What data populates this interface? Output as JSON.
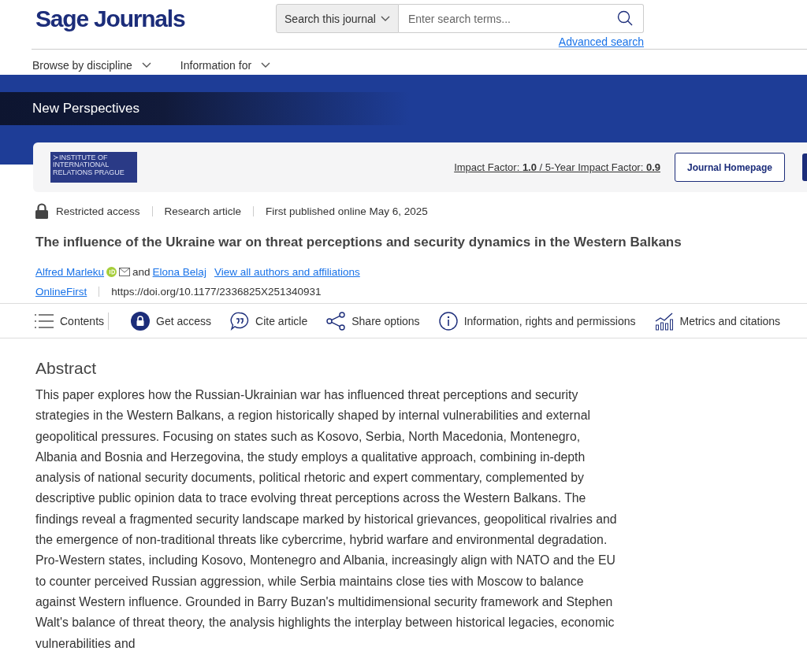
{
  "header": {
    "logo": "Sage Journals",
    "search": {
      "scope": "Search this journal",
      "placeholder": "Enter search terms...",
      "advanced_link": "Advanced search"
    },
    "nav": [
      {
        "label": "Browse by discipline"
      },
      {
        "label": "Information for"
      }
    ]
  },
  "banner": {
    "journal_title": "New Perspectives",
    "publisher_logo": [
      "≻INSTITUTE OF",
      "INTERNATIONAL",
      "RELATIONS PRAGUE"
    ],
    "impact": "Impact Factor: **1.0** / 5-Year Impact Factor: **0.9**",
    "homepage_button": "Journal Homepage"
  },
  "article": {
    "access": "Restricted access",
    "type": "Research article",
    "published": "First published online May 6, 2025",
    "title": "The influence of the Ukraine war on threat perceptions and security dynamics in the Western Balkans",
    "authors": [
      {
        "name": "Alfred Marleku",
        "orcid": true,
        "email": true
      },
      {
        "name": "Elona Belaj",
        "orcid": false,
        "email": false
      }
    ],
    "author_joiner": "and",
    "view_all": "View all authors and affiliations",
    "status": "OnlineFirst",
    "doi": "https://doi.org/10.1177/2336825X251340931"
  },
  "toolbar": [
    {
      "kind": "contents",
      "label": "Contents"
    },
    {
      "kind": "access",
      "label": "Get access"
    },
    {
      "kind": "cite",
      "label": "Cite article"
    },
    {
      "kind": "share",
      "label": "Share options"
    },
    {
      "kind": "info",
      "label": "Information, rights and permissions"
    },
    {
      "kind": "metrics",
      "label": "Metrics and citations"
    }
  ],
  "abstract": {
    "heading": "Abstract",
    "text": "This paper explores how the Russian-Ukrainian war has influenced threat perceptions and security strategies in the Western Balkans, a region historically shaped by internal vulnerabilities and external geopolitical pressures. Focusing on states such as Kosovo, Serbia, North Macedonia, Montenegro, Albania and Bosnia and Herzegovina, the study employs a qualitative approach, combining in-depth analysis of national security documents, political rhetoric and expert commentary, complemented by descriptive public opinion data to trace evolving threat perceptions across the Western Balkans. The findings reveal a fragmented security landscape marked by historical grievances, geopolitical rivalries and the emergence of non-traditional threats like cybercrime, hybrid warfare and environmental degradation. Pro-Western states, including Kosovo, Montenegro and Albania, increasingly align with NATO and the EU to counter perceived Russian aggression, while Serbia maintains close ties with Moscow to balance against Western influence. Grounded in Barry Buzan's multidimensional security framework and Stephen Walt's balance of threat theory, the analysis highlights the interplay between historical legacies, economic vulnerabilities and"
  }
}
